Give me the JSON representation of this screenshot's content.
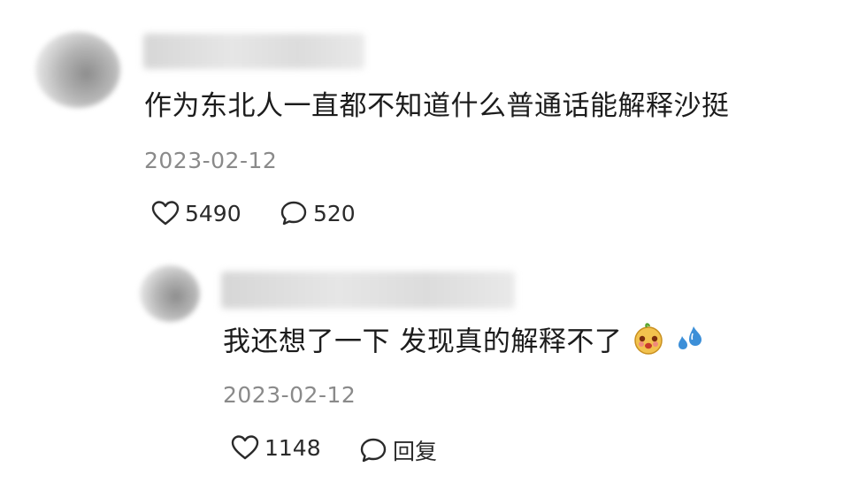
{
  "comment": {
    "text": "作为东北人一直都不知道什么普通话能解释沙挺",
    "date": "2023-02-12",
    "likes": "5490",
    "replies": "520"
  },
  "reply": {
    "text": "我还想了一下 发现真的解释不了",
    "date": "2023-02-12",
    "likes": "1148",
    "reply_label": "回复",
    "emojis": [
      "cute-face-emoji-icon",
      "sweat-drops-emoji-icon"
    ]
  },
  "colors": {
    "text": "#1c1c1c",
    "date": "#8a8a8a",
    "icon": "#2a2a2a"
  }
}
